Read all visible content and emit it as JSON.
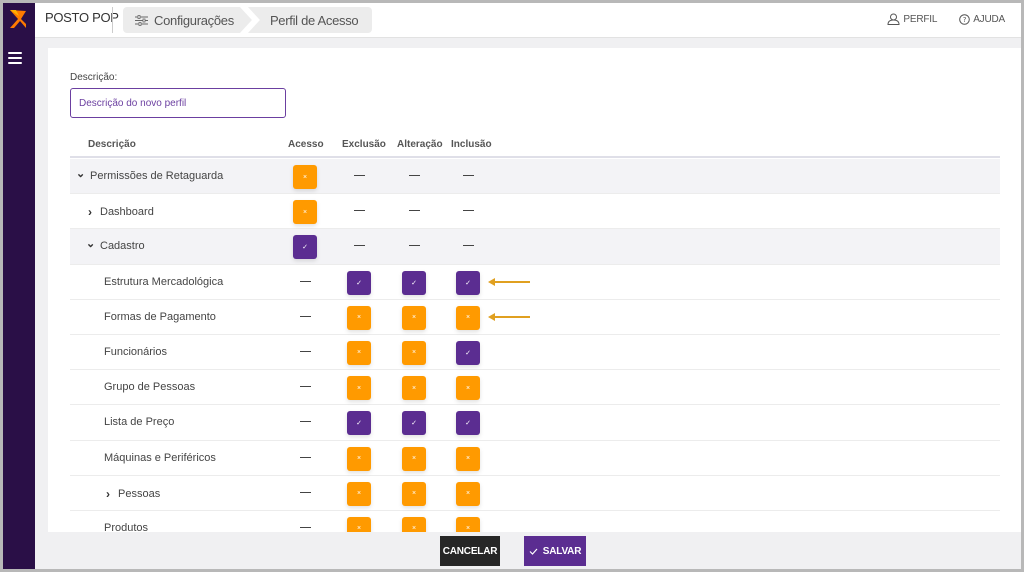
{
  "app": {
    "brand": "POSTO POP",
    "accent": "#5b2d91",
    "warning": "#ff9a00",
    "sidebar_bg": "#2a0f47"
  },
  "breadcrumbs": [
    {
      "label": "Configurações",
      "icon": "sliders-icon"
    },
    {
      "label": "Perfil de Acesso"
    }
  ],
  "top_links": {
    "profile": "PERFIL",
    "help": "AJUDA"
  },
  "form": {
    "description_label": "Descrição:",
    "description_placeholder": "Descrição do novo perfil",
    "description_value": ""
  },
  "table": {
    "columns": [
      "Descrição",
      "Acesso",
      "Exclusão",
      "Alteração",
      "Inclusão"
    ],
    "rows": [
      {
        "name": "Permissões de Retaguarda",
        "level": 0,
        "expander": "down",
        "acesso": "x",
        "exclusao": "-",
        "alteracao": "-",
        "inclusao": "-",
        "shaded": true
      },
      {
        "name": "Dashboard",
        "level": 1,
        "expander": "right",
        "acesso": "x",
        "exclusao": "-",
        "alteracao": "-",
        "inclusao": "-",
        "shaded": false
      },
      {
        "name": "Cadastro",
        "level": 1,
        "expander": "down",
        "acesso": "check",
        "exclusao": "-",
        "alteracao": "-",
        "inclusao": "-",
        "shaded": true
      },
      {
        "name": "Estrutura Mercadológica",
        "level": 2,
        "expander": "",
        "acesso": "-",
        "exclusao": "check",
        "alteracao": "check",
        "inclusao": "check",
        "shaded": false,
        "arrow": true
      },
      {
        "name": "Formas de Pagamento",
        "level": 2,
        "expander": "",
        "acesso": "-",
        "exclusao": "x",
        "alteracao": "x",
        "inclusao": "x",
        "shaded": false,
        "arrow": true
      },
      {
        "name": "Funcionários",
        "level": 2,
        "expander": "",
        "acesso": "-",
        "exclusao": "x",
        "alteracao": "x",
        "inclusao": "check",
        "shaded": false
      },
      {
        "name": "Grupo de Pessoas",
        "level": 2,
        "expander": "",
        "acesso": "-",
        "exclusao": "x",
        "alteracao": "x",
        "inclusao": "x",
        "shaded": false
      },
      {
        "name": "Lista de Preço",
        "level": 2,
        "expander": "",
        "acesso": "-",
        "exclusao": "check",
        "alteracao": "check",
        "inclusao": "check",
        "shaded": false
      },
      {
        "name": "Máquinas e Periféricos",
        "level": 2,
        "expander": "",
        "acesso": "-",
        "exclusao": "x",
        "alteracao": "x",
        "inclusao": "x",
        "shaded": false
      },
      {
        "name": "Pessoas",
        "level": 2,
        "expander": "right",
        "acesso": "-",
        "exclusao": "x",
        "alteracao": "x",
        "inclusao": "x",
        "shaded": false
      },
      {
        "name": "Produtos",
        "level": 2,
        "expander": "",
        "acesso": "-",
        "exclusao": "x",
        "alteracao": "x",
        "inclusao": "x",
        "shaded": false
      }
    ]
  },
  "footer": {
    "cancel": "CANCELAR",
    "save": "SALVAR"
  }
}
